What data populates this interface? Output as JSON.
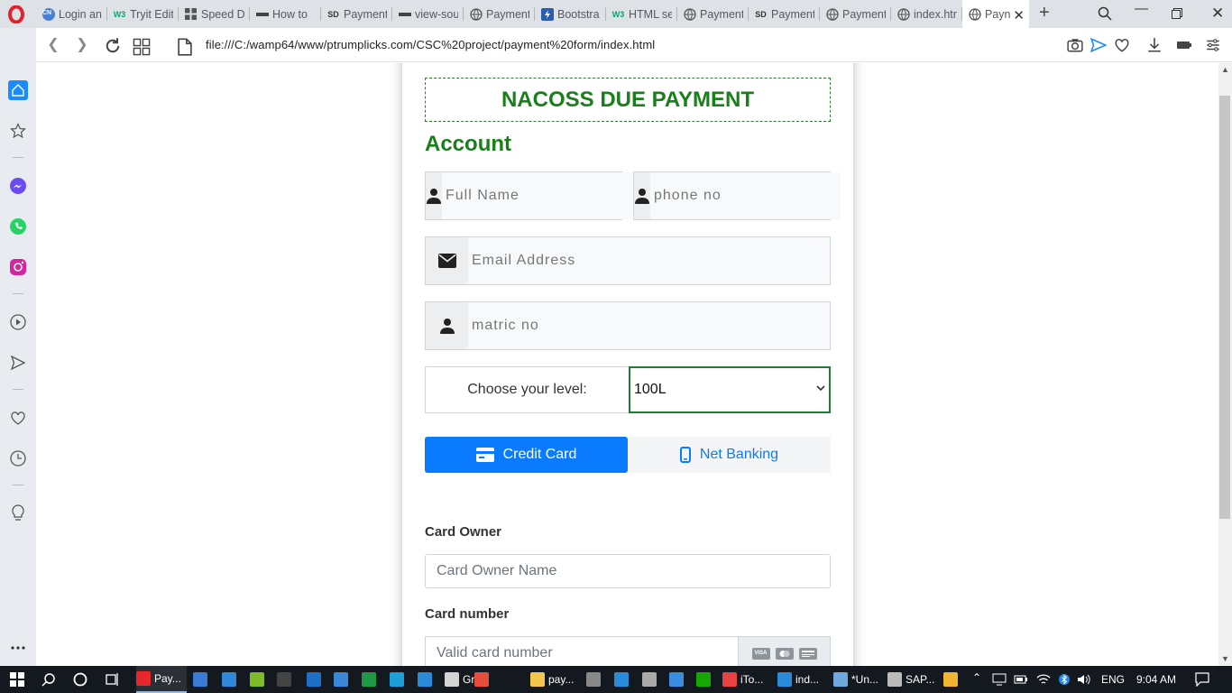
{
  "browser": {
    "tabs": [
      {
        "label": "Login an",
        "favicon": "CN",
        "favicon_color": "#4a7fd4"
      },
      {
        "label": "Tryit Edit",
        "favicon": "W3",
        "favicon_color": "#04aa6d"
      },
      {
        "label": "Speed D",
        "favicon": "grid",
        "favicon_color": "#555555"
      },
      {
        "label": "How to",
        "favicon": "ptrumplicks",
        "favicon_color": "#444444"
      },
      {
        "label": "Payment",
        "favicon": "SD",
        "favicon_color": "#333333"
      },
      {
        "label": "view-sou",
        "favicon": "ptrumplicks",
        "favicon_color": "#444444"
      },
      {
        "label": "Payment",
        "favicon": "globe",
        "favicon_color": "#555555"
      },
      {
        "label": "Bootstra",
        "favicon": "bolt",
        "favicon_color": "#2a5db0"
      },
      {
        "label": "HTML se",
        "favicon": "W3",
        "favicon_color": "#04aa6d"
      },
      {
        "label": "Payment",
        "favicon": "globe",
        "favicon_color": "#555555"
      },
      {
        "label": "Payment",
        "favicon": "SD",
        "favicon_color": "#333333"
      },
      {
        "label": "Payment",
        "favicon": "globe",
        "favicon_color": "#555555"
      },
      {
        "label": "index.htm",
        "favicon": "globe",
        "favicon_color": "#555555"
      },
      {
        "label": "Payn",
        "favicon": "globe",
        "favicon_color": "#555555",
        "active": true
      }
    ],
    "url": "file:///C:/wamp64/www/ptrumplicks.com/CSC%20project/payment%20form/index.html"
  },
  "form": {
    "heading": "NACOSS DUE PAYMENT",
    "section_title": "Account",
    "full_name_placeholder": "Full Name",
    "phone_placeholder": "phone no",
    "email_placeholder": "Email Address",
    "matric_placeholder": "matric no",
    "level_label": "Choose your level:",
    "level_value": "100L",
    "tab_credit": "Credit Card",
    "tab_netbanking": "Net Banking",
    "card_owner_label": "Card Owner",
    "card_owner_placeholder": "Card Owner Name",
    "card_number_label": "Card number",
    "card_number_placeholder": "Valid card number",
    "card_brands": [
      "VISA",
      "MC",
      "AMEX"
    ],
    "accent_color": "#1a7f1a",
    "primary_color": "#0a7bff"
  },
  "taskbar": {
    "apps": [
      {
        "label": "Pay...",
        "icon": "opera-icon",
        "color": "#e6282c"
      },
      {
        "label": "",
        "icon": "store-icon",
        "color": "#3a7bd5"
      },
      {
        "label": "",
        "icon": "files-icon",
        "color": "#2f89d8"
      },
      {
        "label": "",
        "icon": "notepad-icon",
        "color": "#7dbb2a"
      },
      {
        "label": "",
        "icon": "cmd-icon",
        "color": "#444444"
      },
      {
        "label": "",
        "icon": "mail-icon",
        "color": "#1f6fc9"
      },
      {
        "label": "",
        "icon": "explorer-icon",
        "color": "#3a87d8"
      },
      {
        "label": "",
        "icon": "r-icon",
        "color": "#1e9a45"
      },
      {
        "label": "",
        "icon": "edge-icon",
        "color": "#1ba0d8"
      },
      {
        "label": "",
        "icon": "c-icon",
        "color": "#2a8cd8"
      },
      {
        "label": "Gro...",
        "icon": "record-icon",
        "color": "#d4d4d4"
      },
      {
        "label": "",
        "icon": "gear-icon",
        "color": "#e84c3d"
      },
      {
        "label": "pay...",
        "icon": "folder-icon",
        "color": "#f3c64c"
      },
      {
        "label": "",
        "icon": "calculator-icon",
        "color": "#888888"
      },
      {
        "label": "",
        "icon": "ie-icon",
        "color": "#2a8cd8"
      },
      {
        "label": "",
        "icon": "pen-icon",
        "color": "#aaaaaa"
      },
      {
        "label": "",
        "icon": "doc-icon",
        "color": "#3b8de0"
      },
      {
        "label": "",
        "icon": "upwork-icon",
        "color": "#14a800"
      },
      {
        "label": "iTo...",
        "icon": "camera-icon",
        "color": "#e84242"
      },
      {
        "label": "ind...",
        "icon": "vscode-icon",
        "color": "#2a8cd8"
      },
      {
        "label": "*Un...",
        "icon": "notepad2-icon",
        "color": "#6fa8dc"
      },
      {
        "label": "SAP...",
        "icon": "sap-icon",
        "color": "#bbbbbb"
      },
      {
        "label": "",
        "icon": "chrome-icon",
        "color": "#f2b531"
      }
    ],
    "language": "ENG",
    "time": "9:04 AM"
  }
}
